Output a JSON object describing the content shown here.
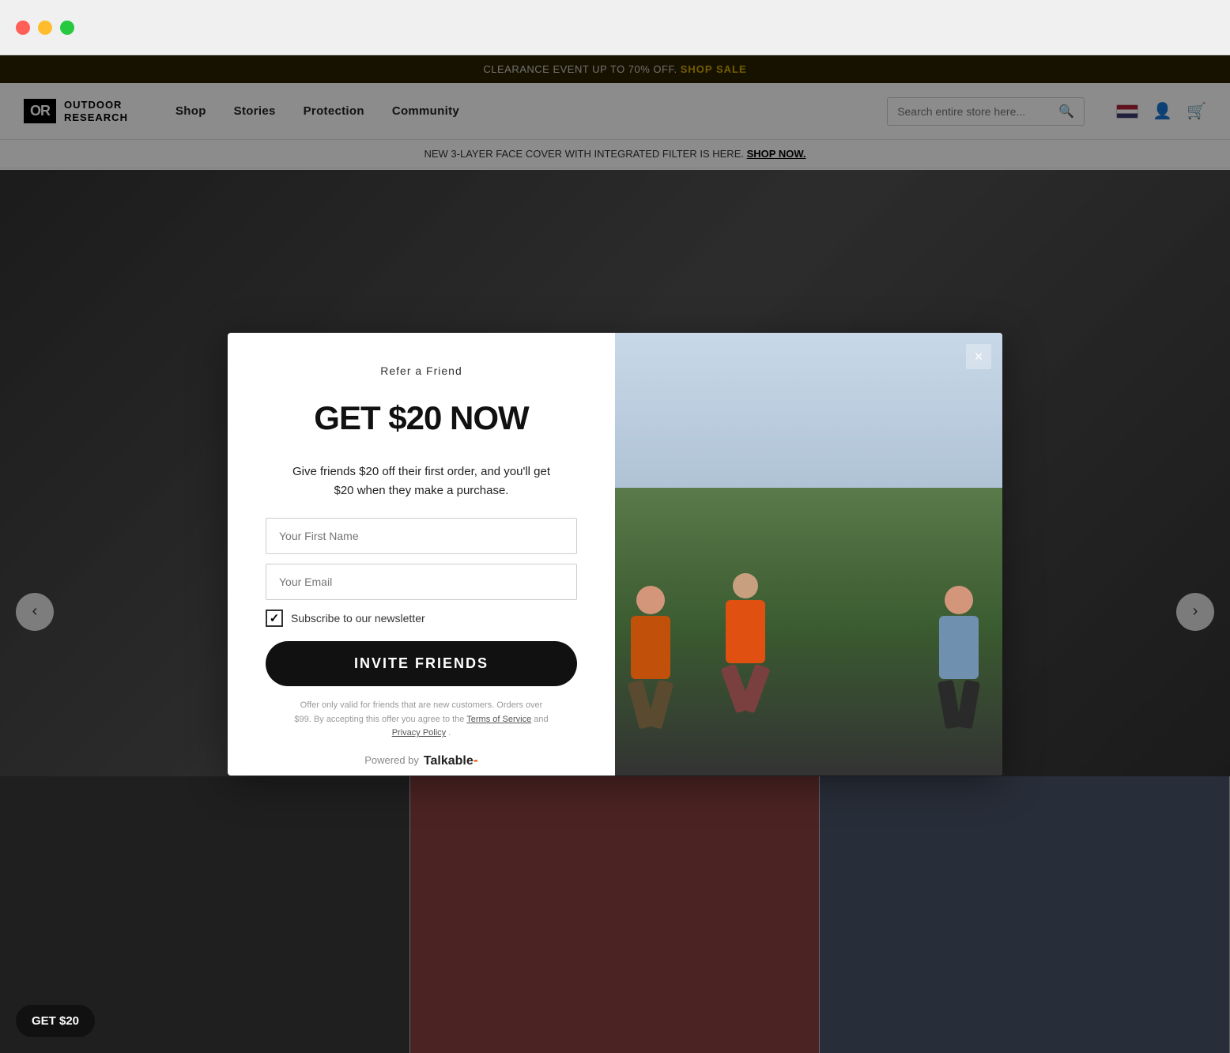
{
  "browser": {
    "traffic_lights": [
      "red",
      "yellow",
      "green"
    ]
  },
  "announcement_bar": {
    "text": "CLEARANCE EVENT UP TO 70% OFF.",
    "link_text": "SHOP SALE",
    "background": "#2a2200"
  },
  "header": {
    "logo_badge": "OR",
    "logo_line1": "OUTDOOR",
    "logo_line2": "RESEARCH",
    "nav_items": [
      "Shop",
      "Stories",
      "Protection",
      "Community"
    ],
    "search_placeholder": "Search entire store here...",
    "icons": [
      "flag",
      "user",
      "cart"
    ]
  },
  "second_bar": {
    "text": "NEW 3-LAYER FACE COVER WITH INTEGRATED FILTER IS HERE.",
    "link_text": "SHOP NOW."
  },
  "modal": {
    "subtitle": "Refer a Friend",
    "title": "GET $20 NOW",
    "description": "Give friends $20 off their first order, and you'll get $20 when they make a purchase.",
    "first_name_placeholder": "Your First Name",
    "email_placeholder": "Your Email",
    "newsletter_label": "Subscribe to our newsletter",
    "newsletter_checked": true,
    "invite_button_label": "INVITE FRIENDS",
    "fine_print": "Offer only valid for friends that are new customers. Orders over $99. By accepting this offer you agree to the",
    "terms_link": "Terms of Service",
    "and_text": "and",
    "privacy_link": "Privacy Policy",
    "powered_by_text": "Powered by",
    "powered_by_brand": "Talkable",
    "close_label": "×"
  },
  "get20_badge": "GET $20"
}
